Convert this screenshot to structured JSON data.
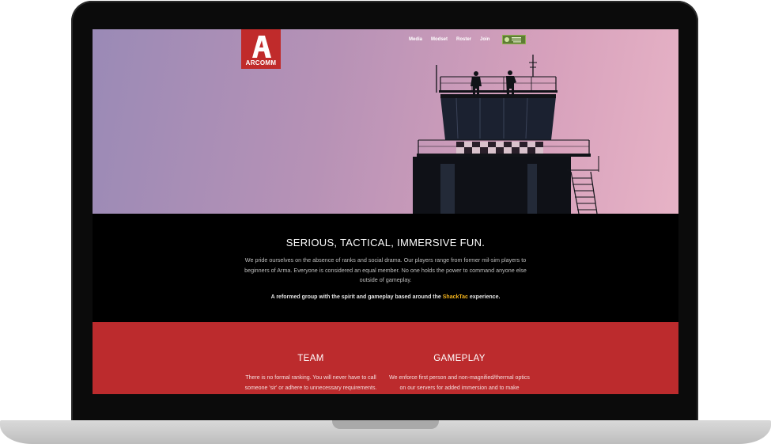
{
  "logo": {
    "text": "ARCOMM"
  },
  "nav": {
    "items": [
      {
        "label": "Media"
      },
      {
        "label": "Modset"
      },
      {
        "label": "Roster"
      },
      {
        "label": "Join"
      }
    ],
    "steam_icon": "steam-icon"
  },
  "intro": {
    "heading": "SERIOUS, TACTICAL, IMMERSIVE FUN.",
    "description": "We pride ourselves on the absence of ranks and social drama. Our players range from former mil-sim players to beginners of Arma. Everyone is considered an equal member. No one holds the power to command anyone else outside of gameplay.",
    "tagline_before": "A reformed group with the spirit and gameplay based around the ",
    "tagline_highlight": "ShackTac",
    "tagline_after": " experience."
  },
  "features": [
    {
      "title": "TEAM",
      "text": "There is no formal ranking. You will never have to call someone 'sir' or adhere to unnecessary requirements."
    },
    {
      "title": "GAMEPLAY",
      "text": "We enforce first person and non-magnified/thermal optics on our servers for added immersion and to make"
    }
  ],
  "colors": {
    "brand_red": "#bc2b2d",
    "highlight": "#f2b21c",
    "hero_gradient_start": "#9a8ab6",
    "hero_gradient_end": "#e7b3c6"
  }
}
